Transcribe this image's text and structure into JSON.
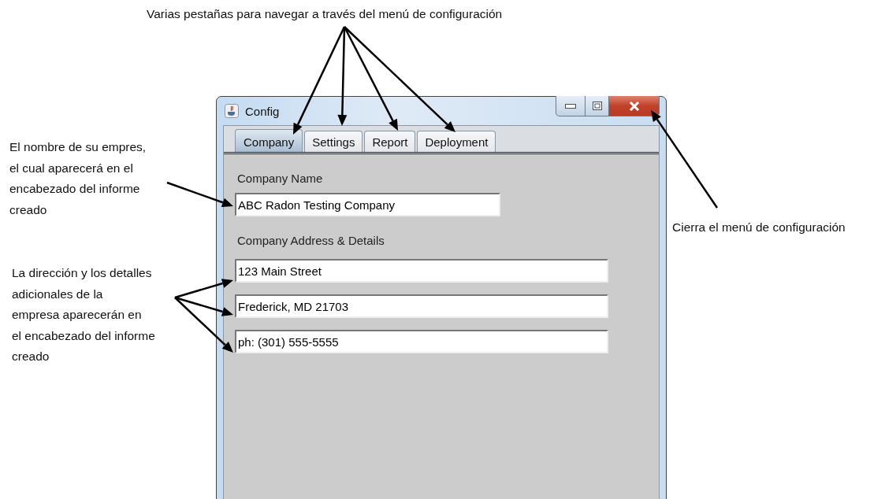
{
  "annotations": [
    {
      "text": "Varias pestañas para navegar a través del menú de configuración"
    },
    {
      "text": "El nombre de su empres,\nel cual aparecerá en el\nencabezado del informe\ncreado"
    },
    {
      "text": "Cierra el menú de configuración"
    },
    {
      "text": "La dirección y los detalles\nadicionales de la\nempresa aparecerán en\nel encabezado del informe\ncreado"
    }
  ],
  "window": {
    "title": "Config",
    "tabs": [
      {
        "label": "Company",
        "selected": true
      },
      {
        "label": "Settings",
        "selected": false
      },
      {
        "label": "Report",
        "selected": false
      },
      {
        "label": "Deployment",
        "selected": false
      }
    ],
    "company_name": {
      "label": "Company Name",
      "value": "ABC Radon Testing Company"
    },
    "address": {
      "label": "Company Address & Details",
      "lines": [
        "123 Main Street",
        "Frederick, MD 21703",
        "ph: (301) 555-5555"
      ]
    }
  }
}
